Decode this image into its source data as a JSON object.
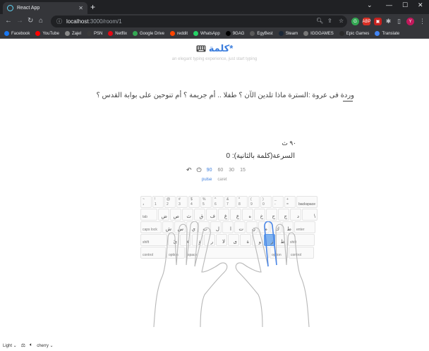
{
  "browser": {
    "tab_title": "React App",
    "url_host": "localhost",
    "url_path": ":3000/room/1",
    "bookmarks": [
      "Facebook",
      "YouTube",
      "Zajel",
      "PSN",
      "Netflix",
      "Google Drive",
      "reddit",
      "WhatsApp",
      "9GAG",
      "EgyBest",
      "Steam",
      "IGGGAMES",
      "Epic Games",
      "Translate"
    ],
    "bookmark_colors": [
      "#1877f2",
      "#ff0000",
      "#888888",
      "#3a3a3a",
      "#e50914",
      "#34a853",
      "#ff4500",
      "#25d366",
      "#000000",
      "#5a5a5a",
      "#1b2838",
      "#777777",
      "#2a2a2a",
      "#4285f4"
    ],
    "profile_initial": "Y"
  },
  "app": {
    "brand": "كلمة*",
    "tagline": "an elegant typing experience, just start typing",
    "text": "وردة فى عروة :السترة  ماذا تلدين الآن ؟  طفلا .. أم جريمة ؟  أم تنوحين على بوابة القدس ؟",
    "timer": "٩٠ ث",
    "speed": "السرعة(كلمة بالثانية): 0",
    "durations": [
      "90",
      "60",
      "30",
      "15"
    ],
    "active_duration": "90",
    "modes": [
      "pulse",
      "caret"
    ],
    "active_mode": "pulse"
  },
  "keyboard": {
    "rows": [
      [
        {
          "t": "~",
          "b": "ذ",
          "w": 16
        },
        {
          "t": "!",
          "b": "1",
          "w": 16
        },
        {
          "t": "@",
          "b": "2",
          "w": 16
        },
        {
          "t": "#",
          "b": "3",
          "w": 16
        },
        {
          "t": "$",
          "b": "4",
          "w": 16
        },
        {
          "t": "%",
          "b": "5",
          "w": 16
        },
        {
          "t": "^",
          "b": "6",
          "w": 16
        },
        {
          "t": "&",
          "b": "7",
          "w": 16
        },
        {
          "t": "*",
          "b": "8",
          "w": 16
        },
        {
          "t": "(",
          "b": "9",
          "w": 16
        },
        {
          "t": ")",
          "b": "0",
          "w": 16
        },
        {
          "t": "_",
          "b": "-",
          "w": 16
        },
        {
          "t": "+",
          "b": "=",
          "w": 16
        },
        {
          "t": "",
          "b": "",
          "r": "backspace",
          "w": 30
        }
      ],
      [
        {
          "t": "",
          "b": "tab",
          "w": 24
        },
        {
          "r": "ض",
          "w": 16
        },
        {
          "r": "ص",
          "w": 16
        },
        {
          "r": "ث",
          "w": 16
        },
        {
          "r": "ق",
          "w": 16
        },
        {
          "r": "ف",
          "w": 16
        },
        {
          "r": "غ",
          "w": 16
        },
        {
          "r": "ع",
          "w": 16
        },
        {
          "r": "ه",
          "w": 16
        },
        {
          "r": "خ",
          "w": 16
        },
        {
          "r": "ح",
          "w": 16
        },
        {
          "r": "ج",
          "w": 16
        },
        {
          "r": "د",
          "w": 16
        },
        {
          "r": "\\",
          "w": 22
        }
      ],
      [
        {
          "t": "",
          "b": "caps lock",
          "w": 30
        },
        {
          "r": "ش",
          "w": 16
        },
        {
          "r": "س",
          "w": 16
        },
        {
          "r": "ي",
          "w": 16
        },
        {
          "r": "ب",
          "w": 16
        },
        {
          "r": "ل",
          "w": 16
        },
        {
          "r": "ا",
          "w": 16
        },
        {
          "r": "ت",
          "w": 16
        },
        {
          "r": "ن",
          "w": 16
        },
        {
          "r": "م",
          "w": 16
        },
        {
          "r": "ك",
          "w": 16
        },
        {
          "r": "ط",
          "w": 16
        },
        {
          "t": "",
          "b": "enter",
          "w": 30
        }
      ],
      [
        {
          "t": "",
          "b": "shift",
          "w": 38
        },
        {
          "r": "ئ",
          "w": 16
        },
        {
          "r": "ء",
          "w": 16
        },
        {
          "r": "ؤ",
          "w": 16
        },
        {
          "r": "ر",
          "w": 16
        },
        {
          "r": "لا",
          "w": 16
        },
        {
          "r": "ى",
          "w": 16
        },
        {
          "r": "ة",
          "w": 16
        },
        {
          "r": "و",
          "w": 16
        },
        {
          "r": "ز",
          "w": 16,
          "hl": true
        },
        {
          "r": "ظ",
          "w": 16
        },
        {
          "t": "",
          "b": "shift",
          "w": 38
        }
      ],
      [
        {
          "t": "",
          "b": "control",
          "w": 36
        },
        {
          "t": "",
          "b": "option",
          "w": 26
        },
        {
          "t": "",
          "b": "space",
          "w": 118
        },
        {
          "t": "",
          "b": "option",
          "w": 26
        },
        {
          "t": "",
          "b": "control",
          "w": 36
        }
      ]
    ]
  },
  "statusbar": {
    "theme": "Light",
    "sound": "cherry"
  }
}
